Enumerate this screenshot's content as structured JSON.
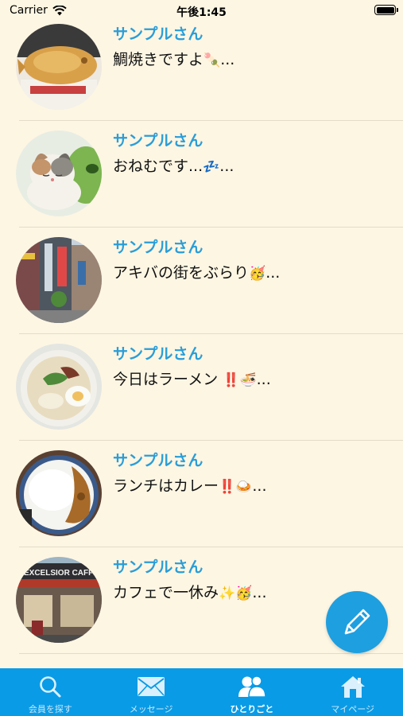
{
  "status_bar": {
    "carrier": "Carrier",
    "time": "午後1:45"
  },
  "posts": [
    {
      "name": "サンプルさん",
      "text": "鯛焼きですよ",
      "emoji": "🍡",
      "ellipsis": "..."
    },
    {
      "name": "サンプルさん",
      "text": "おねむです...",
      "emoji": "💤",
      "ellipsis": "..."
    },
    {
      "name": "サンプルさん",
      "text": "アキバの街をぶらり",
      "emoji": "🥳",
      "ellipsis": "..."
    },
    {
      "name": "サンプルさん",
      "text": "今日はラーメン",
      "emoji": "‼️🍜",
      "ellipsis": "..."
    },
    {
      "name": "サンプルさん",
      "text": "ランチはカレー",
      "emoji": "‼️🍛",
      "ellipsis": "..."
    },
    {
      "name": "サンプルさん",
      "text": "カフェで一休み",
      "emoji": "✨🥳",
      "ellipsis": "..."
    }
  ],
  "avatar_sign_text": "EXCELSIOR CAFFE",
  "tabs": [
    {
      "label": "会員を探す",
      "icon": "search-icon"
    },
    {
      "label": "メッセージ",
      "icon": "envelope-icon"
    },
    {
      "label": "ひとりごと",
      "icon": "people-icon",
      "active": true
    },
    {
      "label": "マイページ",
      "icon": "home-icon"
    }
  ],
  "colors": {
    "background": "#FDF6E3",
    "accent": "#0A9BE6",
    "name": "#2A9DD8"
  }
}
